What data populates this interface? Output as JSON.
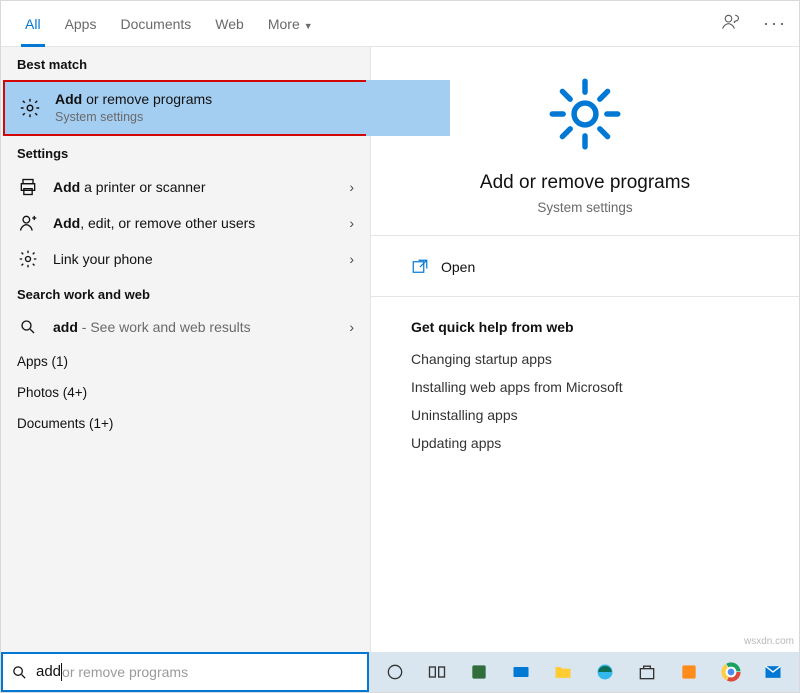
{
  "tabs": {
    "all": "All",
    "apps": "Apps",
    "documents": "Documents",
    "web": "Web",
    "more": "More"
  },
  "left": {
    "best_match": "Best match",
    "result1": {
      "bold": "Add",
      "rest": " or remove programs",
      "sub": "System settings"
    },
    "settings_head": "Settings",
    "row_printer": {
      "bold": "Add",
      "rest": " a printer or scanner"
    },
    "row_users": {
      "bold": "Add",
      "rest": ", edit, or remove other users"
    },
    "row_phone": {
      "text": "Link your phone"
    },
    "search_work_head": "Search work and web",
    "row_webadd": {
      "bold": "add",
      "rest": " - See work and web results"
    },
    "cat_apps": "Apps (1)",
    "cat_photos": "Photos (4+)",
    "cat_docs": "Documents (1+)"
  },
  "right": {
    "title": "Add or remove programs",
    "sub": "System settings",
    "open": "Open",
    "help_head": "Get quick help from web",
    "links": [
      "Changing startup apps",
      "Installing web apps from Microsoft",
      "Uninstalling apps",
      "Updating apps"
    ]
  },
  "search": {
    "typed": "add",
    "ghost": " or remove programs"
  },
  "watermark": "wsxdn.com"
}
